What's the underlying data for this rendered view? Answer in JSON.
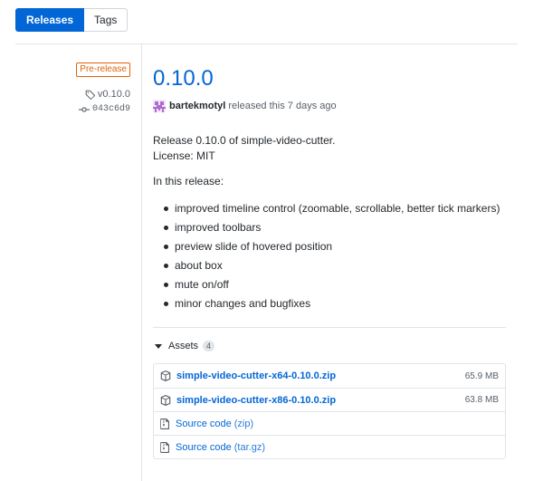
{
  "tabs": [
    {
      "label": "Releases",
      "active": true
    },
    {
      "label": "Tags",
      "active": false
    }
  ],
  "sidebar": {
    "prerelease_label": "Pre-release",
    "tag": "v0.10.0",
    "commit": "043c6d9"
  },
  "release": {
    "title": "0.10.0",
    "author": "bartekmotyl",
    "released_text": "released this 7 days ago",
    "body": {
      "line1": "Release 0.10.0 of simple-video-cutter.",
      "line2": "License: MIT",
      "intro": "In this release:",
      "items": [
        "improved timeline control (zoomable, scrollable, better tick markers)",
        "improved toolbars",
        "preview slide of hovered position",
        "about box",
        "mute on/off",
        "minor changes and bugfixes"
      ]
    }
  },
  "assets": {
    "label": "Assets",
    "count": "4",
    "files": [
      {
        "name": "simple-video-cutter-x64-0.10.0.zip",
        "size": "65.9 MB"
      },
      {
        "name": "simple-video-cutter-x86-0.10.0.zip",
        "size": "63.8 MB"
      }
    ],
    "sources": [
      {
        "label": "Source code",
        "format": "(zip)"
      },
      {
        "label": "Source code",
        "format": "(tar.gz)"
      }
    ]
  },
  "colors": {
    "accent": "#0366d6",
    "prerelease": "#e36209",
    "border": "#e1e4e8"
  },
  "icons": [
    "tag-icon",
    "commit-icon",
    "package-icon",
    "file-zip-icon",
    "caret-down-icon",
    "avatar"
  ]
}
